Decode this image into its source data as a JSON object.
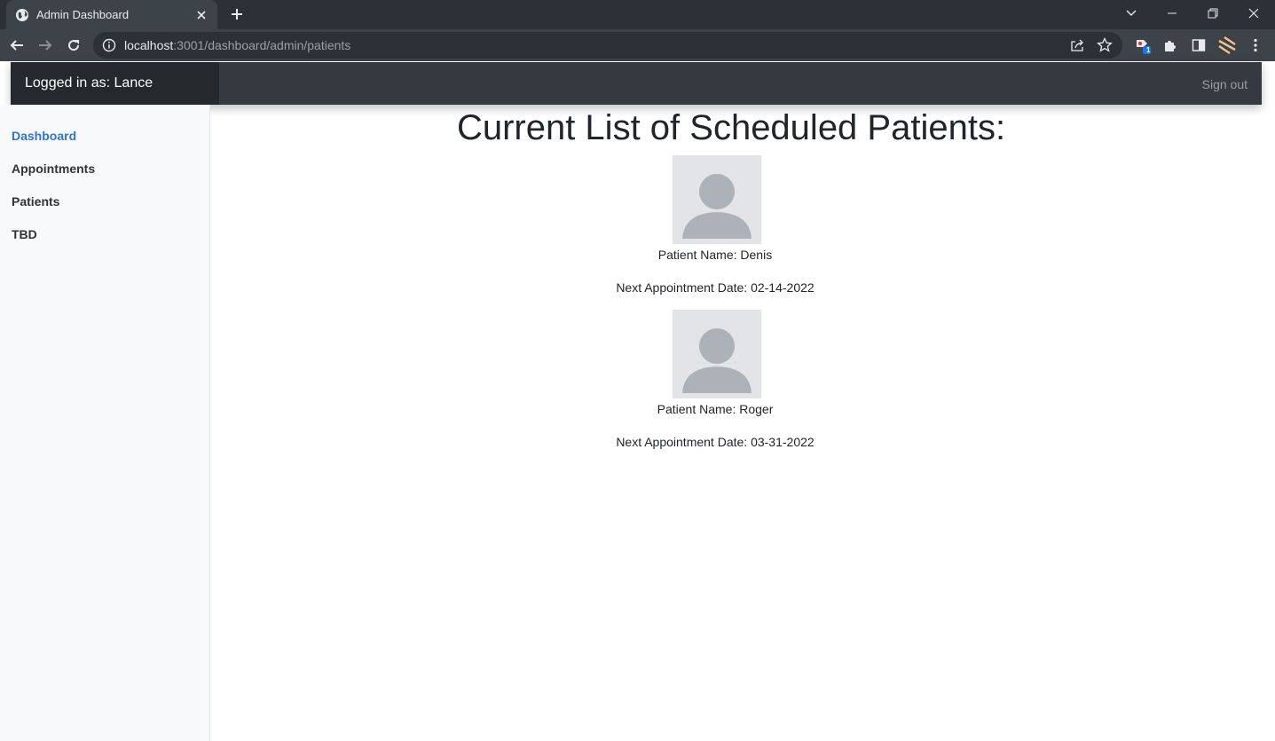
{
  "browser": {
    "tab_title": "Admin Dashboard",
    "url_host": "localhost",
    "url_rest": ":3001/dashboard/admin/patients",
    "extension_badge": "1"
  },
  "header": {
    "logged_in_label": "Logged in as: Lance",
    "sign_out_label": "Sign out"
  },
  "sidebar": {
    "items": [
      {
        "label": "Dashboard",
        "active": true
      },
      {
        "label": "Appointments",
        "active": false
      },
      {
        "label": "Patients",
        "active": false
      },
      {
        "label": "TBD",
        "active": false
      }
    ]
  },
  "main": {
    "title": "Current List of Scheduled Patients:",
    "patients": [
      {
        "name": "Patient Name: Denis",
        "next_appointment": "Next Appointment Date: 02-14-2022"
      },
      {
        "name": "Patient Name: Roger",
        "next_appointment": "Next Appointment Date: 03-31-2022"
      }
    ]
  },
  "colors": {
    "accent": "#2f73d3",
    "appbar": "#343a40",
    "sidebar_bg": "#f8f9fa"
  }
}
